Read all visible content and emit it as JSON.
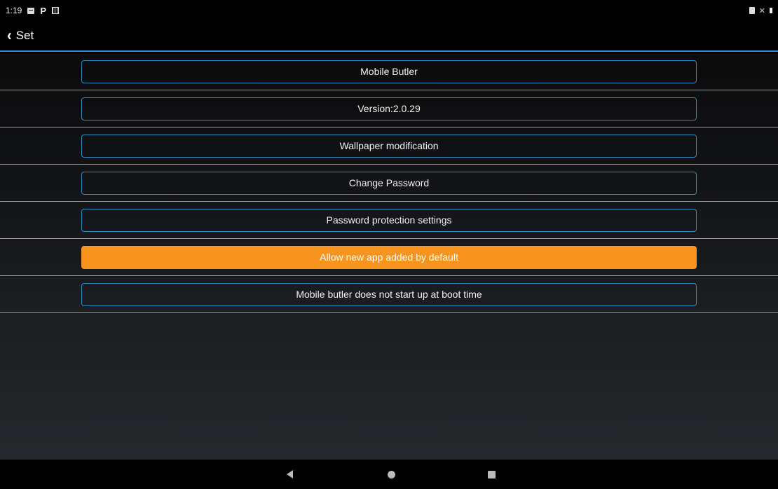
{
  "status_bar": {
    "time": "1:19",
    "left_icons": [
      "message-icon",
      "p-icon",
      "grid-icon"
    ],
    "right_icons": [
      "phone-icon",
      "mute-icon",
      "battery-icon"
    ]
  },
  "title_bar": {
    "title": "Set"
  },
  "settings": {
    "items": [
      {
        "label": "Mobile Butler"
      },
      {
        "label": "Version:2.0.29"
      },
      {
        "label": "Wallpaper modification"
      },
      {
        "label": "Change Password"
      },
      {
        "label": "Password protection settings"
      },
      {
        "label": "Allow new app added by default"
      },
      {
        "label": "Mobile butler does not start up at boot time"
      }
    ]
  },
  "colors": {
    "accent": "#2f8cc4",
    "highlight": "#f7941d"
  }
}
